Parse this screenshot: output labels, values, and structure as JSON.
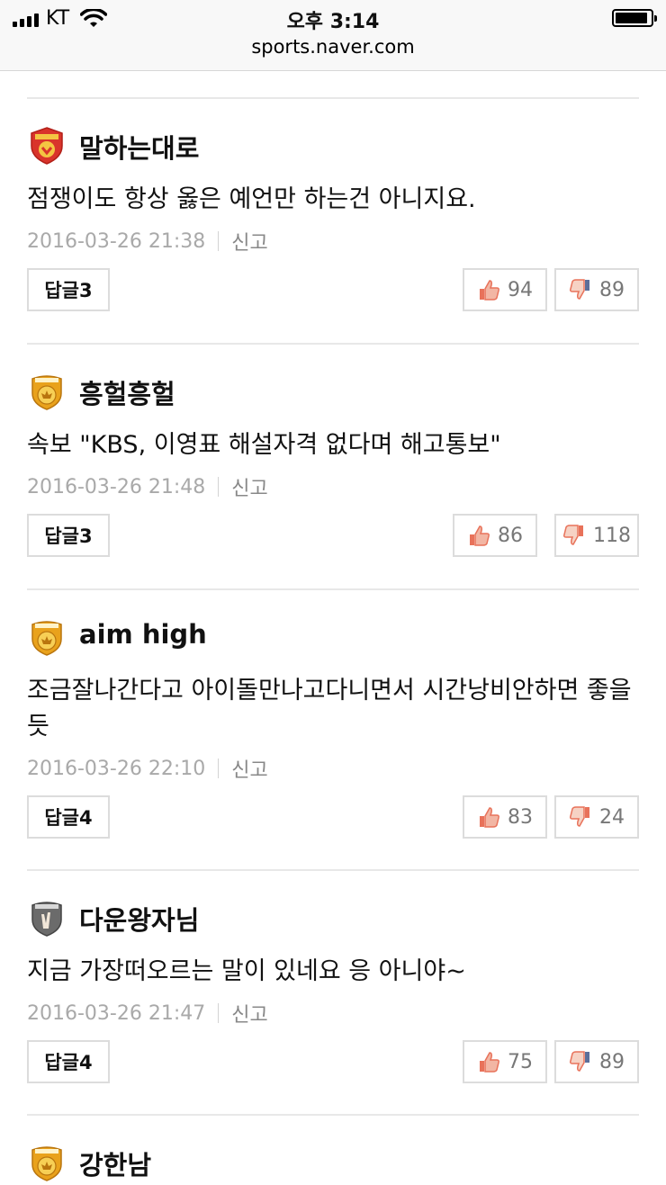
{
  "status_bar": {
    "carrier": "KT",
    "time": "오후 3:14",
    "url": "sports.naver.com"
  },
  "comments": [
    {
      "username": "말하는대로",
      "badge": "red",
      "badge_label": "GENPRO",
      "text": "점쟁이도 항상 옳은 예언만 하는건 아니지요.",
      "timestamp": "2016-03-26 21:38",
      "report_label": "신고",
      "reply_label": "답글3",
      "likes": "94",
      "dislikes": "89"
    },
    {
      "username": "흥헐흥헐",
      "badge": "gold",
      "badge_label": "MASTER",
      "text": "속보 \"KBS, 이영표 해설자격 없다며 해고통보\"",
      "timestamp": "2016-03-26 21:48",
      "report_label": "신고",
      "reply_label": "답글3",
      "likes": "86",
      "dislikes": "118"
    },
    {
      "username": "aim high",
      "badge": "gold",
      "badge_label": "MASTER",
      "text": "조금잘나간다고 아이돌만나고다니면서 시간낭비안하면 좋을듯",
      "timestamp": "2016-03-26 22:10",
      "report_label": "신고",
      "reply_label": "답글4",
      "likes": "83",
      "dislikes": "24"
    },
    {
      "username": "다운왕자님",
      "badge": "gray",
      "badge_label": "ROOKIE",
      "text": "지금 가장떠오르는 말이 있네요 응 아니야~",
      "timestamp": "2016-03-26 21:47",
      "report_label": "신고",
      "reply_label": "답글4",
      "likes": "75",
      "dislikes": "89"
    },
    {
      "username": "강한남",
      "badge": "gold",
      "badge_label": "MASTER"
    }
  ],
  "colors": {
    "like_thumb": "#e8725a",
    "dislike_thumb": "#e8725a",
    "badge_red": "#d9342b",
    "badge_gold": "#e9a21c",
    "badge_gray": "#6b6b6b"
  }
}
